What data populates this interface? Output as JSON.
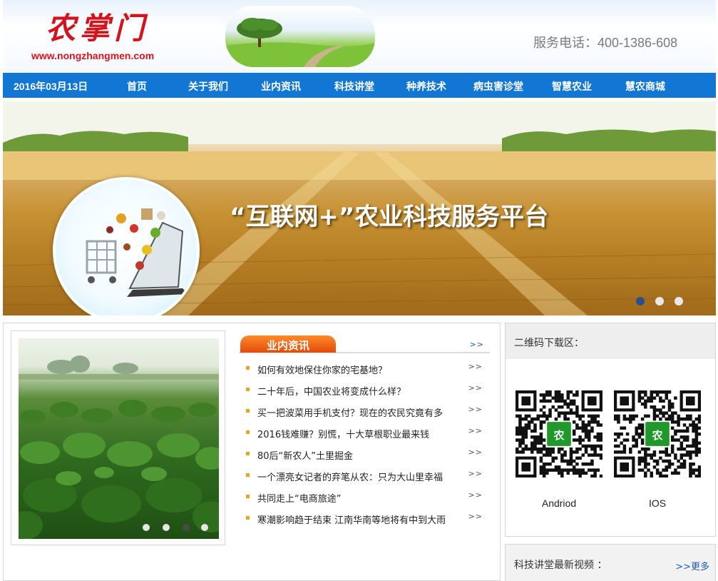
{
  "header": {
    "logo_text": "农掌门",
    "logo_url": "www.nongzhangmen.com",
    "hotline": "服务电话：400-1386-608"
  },
  "nav": {
    "date": "2016年03月13日",
    "items": [
      {
        "label": "首页"
      },
      {
        "label": "关于我们"
      },
      {
        "label": "业内资讯"
      },
      {
        "label": "科技讲堂"
      },
      {
        "label": "种养技术"
      },
      {
        "label": "病虫害诊堂"
      },
      {
        "label": "智慧农业"
      },
      {
        "label": "慧农商城"
      }
    ]
  },
  "banner": {
    "headline": "“互联网+”农业科技服务平台",
    "slide_count": 3,
    "active_slide": 1
  },
  "photo_slider": {
    "slide_count": 4,
    "active_slide": 3
  },
  "news": {
    "tab_label": "业内资讯",
    "more": ">>",
    "row_arrow": ">>",
    "items": [
      "如何有效地保住你家的宅基地？",
      "二十年后，中国农业将变成什么样？",
      "买一把波菜用手机支付？现在的农民究竟有多",
      "2016钱难赚？别慌，十大草根职业最来钱",
      "80后“新农人”土里掘金",
      "一个漂亮女记者的弃笔从农：只为大山里幸福",
      "共同走上“电商旅途”",
      "寒潮影响趋于结束 江南华南等地将有中到大雨"
    ]
  },
  "qr": {
    "title": "二维码下载区：",
    "badge": "农",
    "android_label": "Andriod",
    "ios_label": "IOS"
  },
  "video": {
    "title": "科技讲堂最新视频 ：",
    "more": ">>更多"
  },
  "colors": {
    "nav_blue": "#1176d4",
    "logo_red": "#d3141c",
    "tab_orange": "#e24a0c",
    "bullet_orange": "#f0a21a",
    "qr_green": "#1f9a2a"
  }
}
